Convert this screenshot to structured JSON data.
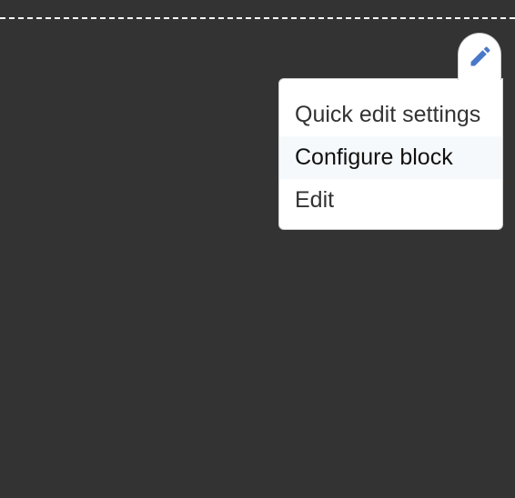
{
  "contextual_links": {
    "trigger": {
      "icon": "pencil-icon",
      "icon_color": "#4a78c8"
    },
    "items": [
      {
        "label": "Quick edit settings"
      },
      {
        "label": "Configure block"
      },
      {
        "label": "Edit"
      }
    ],
    "highlighted_item": "Configure block"
  },
  "colors": {
    "page_background": "#333333",
    "divider": "#ffffff",
    "menu_background": "#ffffff",
    "highlight_background": "#f6f9fb",
    "text": "#333333"
  }
}
